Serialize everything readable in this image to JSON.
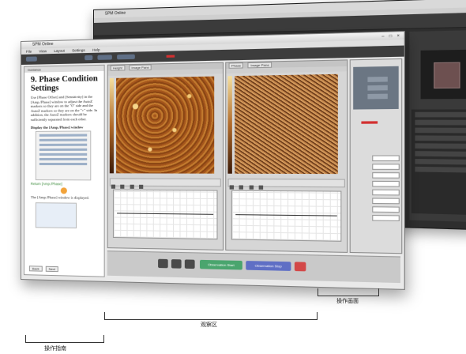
{
  "back_window": {
    "title": "SPM Online"
  },
  "front_window": {
    "title": "SPM Online",
    "window_controls": "– □ ×",
    "menu": [
      "File",
      "View",
      "Layout",
      "Settings",
      "Help"
    ]
  },
  "guide": {
    "tab_label": "Guidance",
    "heading": "9. Phase Condition Settings",
    "body": "Use [Phase Offset] and [Sensitivity] in the [Amp./Phase] window to adjust the AutoZ markers so they are on the \"0\" side and the AutoZ markers so they are on the \"+\" side. In addition, the AutoZ markers should be sufficiently separated from each other.",
    "step_label": "Display the [Amp./Phase] window",
    "note": "Return [Amp./Phase]",
    "caption": "The [Amp./Phase] window is displayed.",
    "nav_buttons": [
      "Back",
      "Next"
    ]
  },
  "observation": {
    "pane1_tabs": [
      "Height",
      "Image Pane"
    ],
    "pane2_tabs": [
      "Phase",
      "Image Pane"
    ]
  },
  "bottom_bar": {
    "green_label": "Observation Start",
    "blue_label": "Observation Stop"
  },
  "annotations": {
    "guide_label": "操作指南",
    "observe_label": "观察区",
    "operate_label": "操作画面"
  }
}
